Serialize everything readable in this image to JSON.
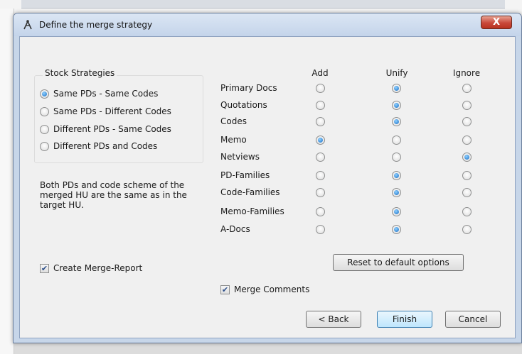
{
  "dialog": {
    "title": "Define the merge strategy",
    "close_label": "X"
  },
  "stock_strategies": {
    "title": "Stock Strategies",
    "options": [
      {
        "label": "Same PDs - Same Codes",
        "selected": true
      },
      {
        "label": "Same PDs - Different Codes",
        "selected": false
      },
      {
        "label": "Different PDs - Same Codes",
        "selected": false
      },
      {
        "label": "Different PDs and Codes",
        "selected": false
      }
    ],
    "description": "Both PDs and code scheme of the merged HU are the same as in the target HU."
  },
  "options_matrix": {
    "columns": [
      "Add",
      "Unify",
      "Ignore"
    ],
    "rows": [
      {
        "label": "Primary Docs",
        "selected": "Unify"
      },
      {
        "label": "Quotations",
        "selected": "Unify"
      },
      {
        "label": "Codes",
        "selected": "Unify"
      },
      {
        "label": "Memo",
        "selected": "Add"
      },
      {
        "label": "Netviews",
        "selected": "Ignore"
      },
      {
        "label": "PD-Families",
        "selected": "Unify"
      },
      {
        "label": "Code-Families",
        "selected": "Unify"
      },
      {
        "label": "Memo-Families",
        "selected": "Unify"
      },
      {
        "label": "A-Docs",
        "selected": "Unify"
      }
    ]
  },
  "checkboxes": {
    "create_report": {
      "label": "Create Merge-Report",
      "checked": true
    },
    "merge_comments": {
      "label": "Merge Comments",
      "checked": true
    }
  },
  "buttons": {
    "reset": "Reset to default options",
    "back": "< Back",
    "finish": "Finish",
    "cancel": "Cancel"
  }
}
